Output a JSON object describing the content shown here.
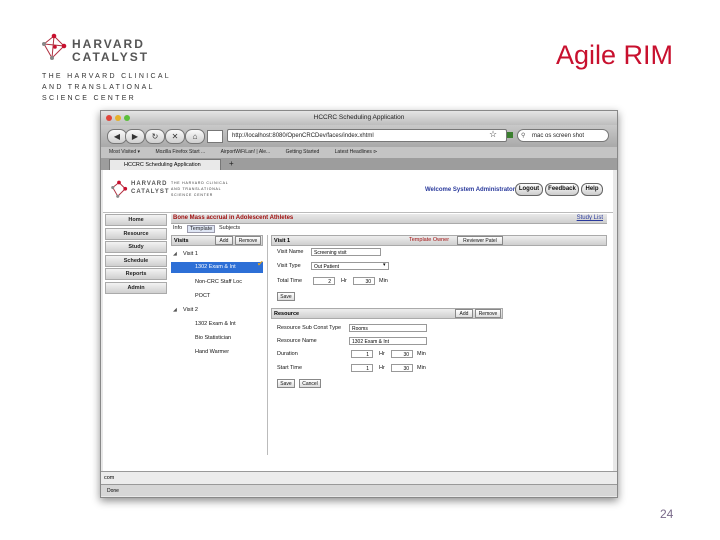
{
  "slide": {
    "title": "Agile RIM",
    "page_number": "24",
    "logo_line1": "HARVARD",
    "logo_line2": "CATALYST",
    "logo_sub": [
      "THE HARVARD CLINICAL",
      "AND TRANSLATIONAL",
      "SCIENCE CENTER"
    ]
  },
  "browser": {
    "window_title": "HCCRC Scheduling Application",
    "url": "http://localhost:8080/OpenCRCDev/faces/index.xhtml",
    "search_value": "mac os screen shot",
    "bookmarks": [
      "Most Visited ▾",
      "Mozilla Firefox Start ...",
      "AirportWiFiLan! | Ale...",
      "Getting Started",
      "Latest Headlines ⊳"
    ],
    "tab_label": "HCCRC Scheduling Application",
    "status_url": "com",
    "status_done": "Done"
  },
  "app": {
    "logo_line1": "HARVARD",
    "logo_line2": "CATALYST",
    "logo_sub": [
      "THE HARVARD CLINICAL",
      "AND TRANSLATIONAL",
      "SCIENCE CENTER"
    ],
    "welcome": "Welcome System Administrator",
    "header_buttons": [
      "Logout",
      "Feedback",
      "Help"
    ],
    "nav": [
      "Home",
      "Resource",
      "Study",
      "Schedule",
      "Reports",
      "Admin"
    ],
    "project_title": "Bone Mass accrual in Adolescent Athletes",
    "study_list": "Study List",
    "subtabs": [
      "Info",
      "Template",
      "Subjects"
    ],
    "visits_panel": {
      "header": "Visits",
      "add": "Add",
      "remove": "Remove",
      "items": [
        "Visit 1",
        "1302 Exam & Int",
        "Non-CRC Staff Loc",
        "POCT",
        "Visit 2",
        "1302 Exam & Int",
        "Bio Statistician",
        "Hand Warmer"
      ]
    },
    "visit_panel": {
      "header": "Visit 1",
      "template_owner_label": "Template Owner",
      "template_owner_btn": "Reviewer Patel",
      "visit_name_label": "Visit Name",
      "visit_name_value": "Screening visit",
      "visit_type_label": "Visit Type",
      "visit_type_value": "Out Patient",
      "total_time_label": "Total Time",
      "total_hr_value": "2",
      "hr_label": "Hr",
      "total_min_value": "30",
      "min_label": "Min",
      "save": "Save"
    },
    "resource_panel": {
      "header": "Resource",
      "add": "Add",
      "remove": "Remove",
      "sublabel_type": "Resource Sub Const Type",
      "sublabel_type_value": "Rooms",
      "resource_name_label": "Resource Name",
      "resource_name_value": "1302 Exam & Int",
      "duration_label": "Duration",
      "duration_hr": "1",
      "duration_min": "30",
      "start_time_label": "Start Time",
      "start_hr": "1",
      "start_min": "30",
      "hr_label": "Hr",
      "min_label": "Min",
      "save": "Save",
      "cancel": "Cancel"
    }
  },
  "colors": {
    "title_red": "#c8102e",
    "selection_blue": "#2d6fd6",
    "link_blue": "#2a3a9c"
  }
}
